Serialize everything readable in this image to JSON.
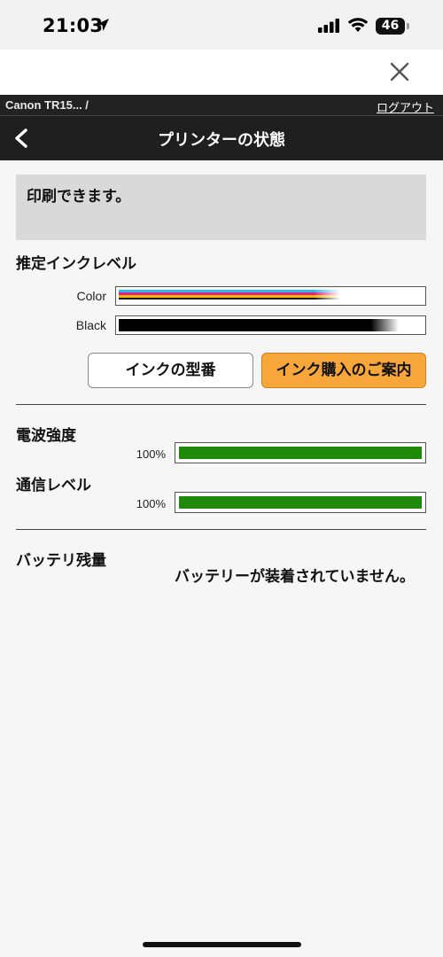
{
  "status_bar": {
    "time": "21:03",
    "battery": "46",
    "icons": [
      "location-arrow-icon",
      "signal-icon",
      "wifi-icon",
      "battery-icon"
    ]
  },
  "header": {
    "close_icon": "close-icon",
    "breadcrumb": "Canon TR15... /",
    "logout": "ログアウト",
    "back_icon": "chevron-left-icon",
    "title": "プリンターの状態"
  },
  "status_message": "印刷できます。",
  "ink": {
    "title": "推定インクレベル",
    "color_label": "Color",
    "black_label": "Black",
    "color_level": 0.73,
    "black_level": 0.92,
    "model_button": "インクの型番",
    "buy_button": "インク購入のご案内"
  },
  "signal": {
    "title": "電波強度",
    "percent": "100%",
    "level": 1.0
  },
  "comm": {
    "title": "通信レベル",
    "percent": "100%",
    "level": 1.0
  },
  "battery": {
    "title": "バッテリ残量",
    "text": "バッテリーが装着されていません。"
  },
  "colors": {
    "accent_orange": "#f7a63a",
    "level_green": "#1f8a0a",
    "header_dark": "#1f1f1f"
  }
}
